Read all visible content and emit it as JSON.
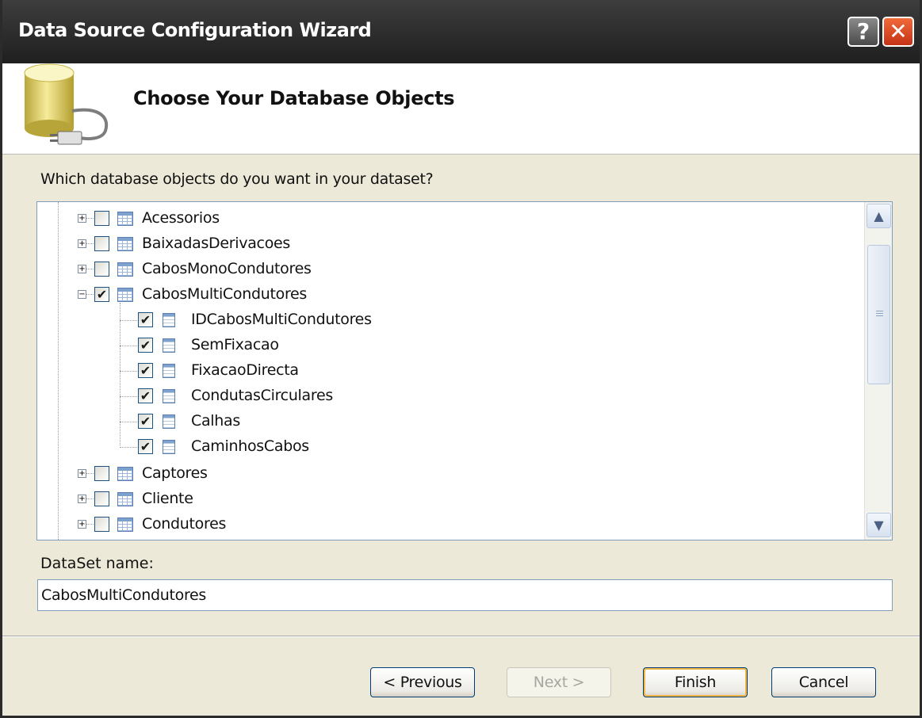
{
  "window": {
    "title": "Data Source Configuration Wizard",
    "help_label": "?",
    "close_label": "✕"
  },
  "header": {
    "title": "Choose Your Database Objects",
    "icon": "database-plug-icon"
  },
  "prompt": "Which database objects do you want in your dataset?",
  "tree": {
    "items": [
      {
        "label": "Acessorios",
        "kind": "table",
        "checked": false,
        "expanded": false
      },
      {
        "label": "BaixadasDerivacoes",
        "kind": "table",
        "checked": false,
        "expanded": false
      },
      {
        "label": "CabosMonoCondutores",
        "kind": "table",
        "checked": false,
        "expanded": false
      },
      {
        "label": "CabosMultiCondutores",
        "kind": "table",
        "checked": true,
        "expanded": true
      },
      {
        "label": "IDCabosMultiCondutores",
        "kind": "column",
        "checked": true
      },
      {
        "label": "SemFixacao",
        "kind": "column",
        "checked": true
      },
      {
        "label": "FixacaoDirecta",
        "kind": "column",
        "checked": true
      },
      {
        "label": "CondutasCirculares",
        "kind": "column",
        "checked": true
      },
      {
        "label": "Calhas",
        "kind": "column",
        "checked": true
      },
      {
        "label": "CaminhosCabos",
        "kind": "column",
        "checked": true
      },
      {
        "label": "Captores",
        "kind": "table",
        "checked": false,
        "expanded": false
      },
      {
        "label": "Cliente",
        "kind": "table",
        "checked": false,
        "expanded": false
      },
      {
        "label": "Condutores",
        "kind": "table",
        "checked": false,
        "expanded": false
      }
    ],
    "scroll": {
      "up": "▲",
      "down": "▼"
    }
  },
  "dataset": {
    "label": "DataSet name:",
    "value": "CabosMultiCondutores"
  },
  "buttons": {
    "previous": "< Previous",
    "next": "Next >",
    "finish": "Finish",
    "cancel": "Cancel"
  },
  "glyphs": {
    "check": "✔",
    "plus": "+",
    "minus": "−"
  },
  "colors": {
    "titlebar": "#2b2b2b",
    "close": "#d9431d",
    "dialog_bg": "#ece9d8",
    "accent_border": "#7f9db9"
  }
}
